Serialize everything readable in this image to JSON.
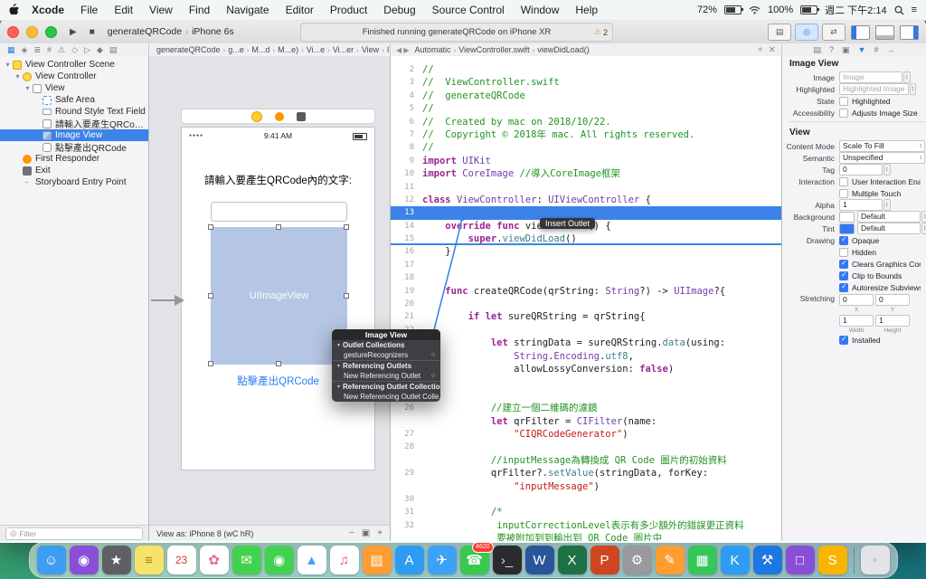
{
  "menubar": {
    "menus": [
      "Xcode",
      "File",
      "Edit",
      "View",
      "Find",
      "Navigate",
      "Editor",
      "Product",
      "Debug",
      "Source Control",
      "Window",
      "Help"
    ],
    "status": {
      "battery_pct": "72%",
      "volume_pct": "100%",
      "clock": "週二 下午2:14"
    }
  },
  "toolbar": {
    "scheme": "generateQRCode",
    "device": "iPhone 6s",
    "status_text": "Finished running generateQRCode on iPhone XR",
    "warning_count": "2"
  },
  "navigator": {
    "filter_placeholder": "Filter",
    "tree": [
      {
        "label": "View Controller Scene",
        "indent": 0,
        "icon": "scene",
        "disclosure": true
      },
      {
        "label": "View Controller",
        "indent": 1,
        "icon": "vc",
        "disclosure": true
      },
      {
        "label": "View",
        "indent": 2,
        "icon": "view",
        "disclosure": true
      },
      {
        "label": "Safe Area",
        "indent": 3,
        "icon": "safearea"
      },
      {
        "label": "Round Style Text Field",
        "indent": 3,
        "icon": "textfield"
      },
      {
        "label": "請輸入要產生QRCode內的...",
        "indent": 3,
        "icon": "label"
      },
      {
        "label": "Image View",
        "indent": 3,
        "icon": "imageview",
        "selected": true
      },
      {
        "label": "點擊產出QRCode",
        "indent": 3,
        "icon": "button"
      },
      {
        "label": "First Responder",
        "indent": 1,
        "icon": "firstresponder"
      },
      {
        "label": "Exit",
        "indent": 1,
        "icon": "exit"
      },
      {
        "label": "Storyboard Entry Point",
        "indent": 1,
        "icon": "entrypoint"
      }
    ]
  },
  "canvas": {
    "breadcrumb": [
      "generateQRCode",
      "g...e",
      "M...d",
      "M...e)",
      "Vi...e",
      "Vi...er",
      "View",
      "Image View"
    ],
    "status_time": "9:41 AM",
    "prompt_label": "請輸入要產生QRCode內的文字:",
    "imageview_label": "UIImageView",
    "button_label": "點擊產出QRCode",
    "view_as": "View as: iPhone 8 (wC hR)",
    "hud": {
      "title": "Image View",
      "rows": [
        {
          "label": "Outlet Collections",
          "group": true
        },
        {
          "label": "gestureRecognizers",
          "circle": true
        },
        {
          "label": "Referencing Outlets",
          "group": true
        },
        {
          "label": "New Referencing Outlet",
          "circle": true
        },
        {
          "label": "Referencing Outlet Collections",
          "group": true
        },
        {
          "label": "New Referencing Outlet Colle...",
          "circle": true
        }
      ]
    }
  },
  "editor": {
    "jumpbar": [
      "Automatic",
      "ViewController.swift",
      "viewDidLoad()"
    ],
    "tooltip": "Insert Outlet",
    "lines": [
      {
        "n": "2",
        "segs": [
          [
            "c",
            "//"
          ]
        ]
      },
      {
        "n": "3",
        "segs": [
          [
            "c",
            "//  ViewController.swift"
          ]
        ]
      },
      {
        "n": "4",
        "segs": [
          [
            "c",
            "//  generateQRCode"
          ]
        ]
      },
      {
        "n": "5",
        "segs": [
          [
            "c",
            "//"
          ]
        ]
      },
      {
        "n": "6",
        "segs": [
          [
            "c",
            "//  Created by mac on 2018/10/22."
          ]
        ]
      },
      {
        "n": "7",
        "segs": [
          [
            "c",
            "//  Copyright © 2018年 mac. All rights reserved."
          ]
        ]
      },
      {
        "n": "8",
        "segs": [
          [
            "c",
            "//"
          ]
        ]
      },
      {
        "n": "9",
        "segs": [
          [
            "k",
            "import"
          ],
          [
            "p",
            " "
          ],
          [
            "t",
            "UIKit"
          ]
        ]
      },
      {
        "n": "10",
        "segs": [
          [
            "k",
            "import"
          ],
          [
            "p",
            " "
          ],
          [
            "t",
            "CoreImage"
          ],
          [
            "p",
            " "
          ],
          [
            "c",
            "//導入CoreImage框架"
          ]
        ]
      },
      {
        "n": "11",
        "segs": []
      },
      {
        "n": "12",
        "segs": [
          [
            "k",
            "class"
          ],
          [
            "p",
            " "
          ],
          [
            "t",
            "ViewController"
          ],
          [
            "p",
            ": "
          ],
          [
            "t",
            "UIViewController"
          ],
          [
            "p",
            " {"
          ]
        ]
      },
      {
        "n": "13",
        "segs": [],
        "hl": true
      },
      {
        "n": "14",
        "segs": [
          [
            "p",
            "    "
          ],
          [
            "k",
            "override"
          ],
          [
            "p",
            " "
          ],
          [
            "k",
            "func"
          ],
          [
            "p",
            " viewDidLoad() {"
          ]
        ]
      },
      {
        "n": "15",
        "segs": [
          [
            "p",
            "        "
          ],
          [
            "k",
            "super"
          ],
          [
            "p",
            "."
          ],
          [
            "m",
            "viewDidLoad"
          ],
          [
            "p",
            "()"
          ]
        ],
        "ul": true
      },
      {
        "n": "16",
        "segs": [
          [
            "p",
            "    }"
          ]
        ]
      },
      {
        "n": "17",
        "segs": []
      },
      {
        "n": "18",
        "segs": []
      },
      {
        "n": "19",
        "segs": [
          [
            "p",
            "    "
          ],
          [
            "k",
            "func"
          ],
          [
            "p",
            " createQRCode(qrString: "
          ],
          [
            "t",
            "String"
          ],
          [
            "p",
            "?) -> "
          ],
          [
            "t",
            "UIImage"
          ],
          [
            "p",
            "?{"
          ]
        ]
      },
      {
        "n": "20",
        "segs": []
      },
      {
        "n": "21",
        "segs": [
          [
            "p",
            "        "
          ],
          [
            "k",
            "if"
          ],
          [
            "p",
            " "
          ],
          [
            "k",
            "let"
          ],
          [
            "p",
            " sureQRString = qrString{"
          ]
        ]
      },
      {
        "n": "22",
        "segs": []
      },
      {
        "n": "23",
        "segs": [
          [
            "p",
            "            "
          ],
          [
            "k",
            "let"
          ],
          [
            "p",
            " stringData = sureQRString."
          ],
          [
            "m",
            "data"
          ],
          [
            "p",
            "(using:"
          ]
        ]
      },
      {
        "n": "",
        "segs": [
          [
            "p",
            "                "
          ],
          [
            "t",
            "String"
          ],
          [
            "p",
            "."
          ],
          [
            "t",
            "Encoding"
          ],
          [
            "p",
            "."
          ],
          [
            "m",
            "utf8"
          ],
          [
            "p",
            ","
          ]
        ]
      },
      {
        "n": "",
        "segs": [
          [
            "p",
            "                allowLossyConversion: "
          ],
          [
            "k",
            "false"
          ],
          [
            "p",
            ")"
          ]
        ]
      },
      {
        "n": "24",
        "segs": []
      },
      {
        "n": "25",
        "segs": []
      },
      {
        "n": "26",
        "segs": [
          [
            "p",
            "            "
          ],
          [
            "c",
            "//建立一個二維碼的濾鏡"
          ]
        ]
      },
      {
        "n": "",
        "segs": [
          [
            "p",
            "            "
          ],
          [
            "k",
            "let"
          ],
          [
            "p",
            " qrFilter = "
          ],
          [
            "t",
            "CIFilter"
          ],
          [
            "p",
            "(name:"
          ]
        ]
      },
      {
        "n": "27",
        "segs": [
          [
            "p",
            "                "
          ],
          [
            "s",
            "\"CIQRCodeGenerator\""
          ],
          [
            "p",
            ")"
          ]
        ]
      },
      {
        "n": "28",
        "segs": []
      },
      {
        "n": "",
        "segs": [
          [
            "p",
            "            "
          ],
          [
            "c",
            "//inputMessage為轉換成 QR Code 圖片的初始資料"
          ]
        ]
      },
      {
        "n": "29",
        "segs": [
          [
            "p",
            "            qrFilter?."
          ],
          [
            "m",
            "setValue"
          ],
          [
            "p",
            "(stringData, forKey:"
          ]
        ]
      },
      {
        "n": "",
        "segs": [
          [
            "p",
            "                "
          ],
          [
            "s",
            "\"inputMessage\""
          ],
          [
            "p",
            ")"
          ]
        ]
      },
      {
        "n": "30",
        "segs": []
      },
      {
        "n": "31",
        "segs": [
          [
            "p",
            "            "
          ],
          [
            "c",
            "/*"
          ]
        ]
      },
      {
        "n": "32",
        "segs": [
          [
            "p",
            "             "
          ],
          [
            "c",
            "inputCorrectionLevel表示有多少額外的錯誤更正資料"
          ]
        ]
      },
      {
        "n": "",
        "segs": [
          [
            "p",
            "             "
          ],
          [
            "c",
            "要被附加到到輸出到 QR Code 圖片中"
          ]
        ]
      }
    ]
  },
  "inspector": {
    "rows": [
      {
        "type": "header",
        "label": "Image View"
      },
      {
        "type": "field",
        "label": "Image",
        "value": "Image",
        "placeholder": true,
        "stepper": true
      },
      {
        "type": "field",
        "label": "Highlighted",
        "value": "Highlighted Image",
        "placeholder": true,
        "stepper": true
      },
      {
        "type": "check",
        "label": "State",
        "text": "Highlighted",
        "checked": false
      },
      {
        "type": "check",
        "label": "Accessibility",
        "text": "Adjusts Image Size",
        "checked": false
      },
      {
        "type": "header",
        "label": "View"
      },
      {
        "type": "popup",
        "label": "Content Mode",
        "value": "Scale To Fill"
      },
      {
        "type": "popup",
        "label": "Semantic",
        "value": "Unspecified"
      },
      {
        "type": "field",
        "label": "Tag",
        "value": "0",
        "stepper": true,
        "num": true
      },
      {
        "type": "check",
        "label": "Interaction",
        "text": "User Interaction Enabled",
        "checked": false
      },
      {
        "type": "check",
        "label": "",
        "text": "Multiple Touch",
        "checked": false
      },
      {
        "type": "field",
        "label": "Alpha",
        "value": "1",
        "stepper": true,
        "num": true
      },
      {
        "type": "color",
        "label": "Background",
        "value": "Default",
        "swatch": "#ffffff"
      },
      {
        "type": "color",
        "label": "Tint",
        "value": "Default",
        "swatch": "#3478f6"
      },
      {
        "type": "check",
        "label": "Drawing",
        "text": "Opaque",
        "checked": true
      },
      {
        "type": "check",
        "label": "",
        "text": "Hidden",
        "checked": false
      },
      {
        "type": "check",
        "label": "",
        "text": "Clears Graphics Context",
        "checked": true
      },
      {
        "type": "check",
        "label": "",
        "text": "Clip to Bounds",
        "checked": true
      },
      {
        "type": "check",
        "label": "",
        "text": "Autoresize Subviews",
        "checked": true
      },
      {
        "type": "stretch",
        "label": "Stretching",
        "x": "0",
        "y": "0",
        "w": "1",
        "h": "1",
        "xl": "X",
        "yl": "Y",
        "wl": "Width",
        "hl2": "Height"
      },
      {
        "type": "check",
        "label": "",
        "text": "Installed",
        "checked": true
      }
    ]
  },
  "dock": {
    "items": [
      {
        "name": "finder",
        "bg": "#3e9df0",
        "fg": "#ffffff",
        "glyph": "☺"
      },
      {
        "name": "siri",
        "bg": "#8a4fd8",
        "fg": "#ffffff",
        "glyph": "◉"
      },
      {
        "name": "launchpad",
        "bg": "#5f5f64",
        "fg": "#ffffff",
        "glyph": "★"
      },
      {
        "name": "notes",
        "bg": "#f7e36a",
        "fg": "#9a8419",
        "glyph": "≡"
      },
      {
        "name": "calendar",
        "bg": "#ffffff",
        "fg": "#e0352b",
        "glyph": "23"
      },
      {
        "name": "photos",
        "bg": "#ffffff",
        "fg": "#e5699e",
        "glyph": "✿"
      },
      {
        "name": "messages",
        "bg": "#43d24f",
        "fg": "#ffffff",
        "glyph": "✉"
      },
      {
        "name": "facetime",
        "bg": "#43d24f",
        "fg": "#ffffff",
        "glyph": "◉"
      },
      {
        "name": "maps",
        "bg": "#ffffff",
        "fg": "#4aa0f4",
        "glyph": "▲"
      },
      {
        "name": "itunes",
        "bg": "#ffffff",
        "fg": "#e84c88",
        "glyph": "♫"
      },
      {
        "name": "books",
        "bg": "#ff9d33",
        "fg": "#ffffff",
        "glyph": "▤"
      },
      {
        "name": "app-store",
        "bg": "#2f9cf4",
        "fg": "#ffffff",
        "glyph": "A"
      },
      {
        "name": "safari",
        "bg": "#3da2f5",
        "fg": "#ffffff",
        "glyph": "✈"
      },
      {
        "name": "line",
        "bg": "#38c94e",
        "fg": "#ffffff",
        "glyph": "☎",
        "badge": "4620"
      },
      {
        "name": "terminal",
        "bg": "#2b2b2e",
        "fg": "#dddddd",
        "glyph": "›_"
      },
      {
        "name": "word",
        "bg": "#2a5699",
        "fg": "#ffffff",
        "glyph": "W"
      },
      {
        "name": "excel",
        "bg": "#1e7145",
        "fg": "#ffffff",
        "glyph": "X"
      },
      {
        "name": "powerpoint",
        "bg": "#cf4520",
        "fg": "#ffffff",
        "glyph": "P"
      },
      {
        "name": "system-preferences",
        "bg": "#98989d",
        "fg": "#ffffff",
        "glyph": "⚙"
      },
      {
        "name": "pages",
        "bg": "#ff9d33",
        "fg": "#ffffff",
        "glyph": "✎"
      },
      {
        "name": "numbers",
        "bg": "#35c759",
        "fg": "#ffffff",
        "glyph": "▦"
      },
      {
        "name": "keynote",
        "bg": "#2f9cf4",
        "fg": "#ffffff",
        "glyph": "K"
      },
      {
        "name": "xcode",
        "bg": "#1c77e0",
        "fg": "#ffffff",
        "glyph": "⚒"
      },
      {
        "name": "simulator",
        "bg": "#8a4fd8",
        "fg": "#ffffff",
        "glyph": "□"
      },
      {
        "name": "sourcetree",
        "bg": "#f7b500",
        "fg": "#ffffff",
        "glyph": "S"
      },
      {
        "name": "trash",
        "bg": "#e3e3e8",
        "fg": "#9a9aa0",
        "glyph": "◦"
      }
    ]
  }
}
